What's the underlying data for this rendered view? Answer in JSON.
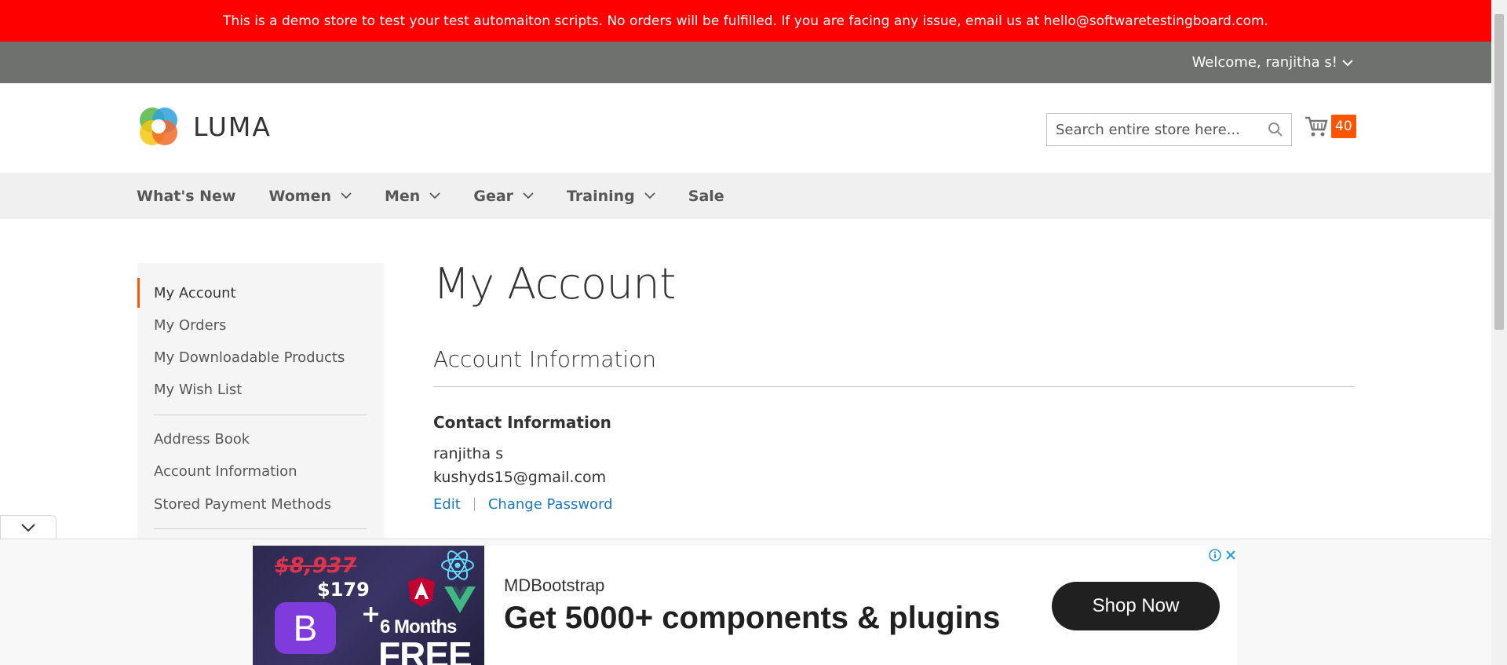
{
  "demo_notice": "This is a demo store to test your test automaiton scripts. No orders will be fulfilled. If you are facing any issue, email us at hello@softwaretestingboard.com.",
  "header": {
    "welcome": "Welcome, ranjitha s!",
    "logo_text": "LUMA",
    "search_placeholder": "Search entire store here...",
    "cart_count": "40"
  },
  "nav": {
    "items": [
      {
        "label": "What's New",
        "has_dropdown": false
      },
      {
        "label": "Women",
        "has_dropdown": true
      },
      {
        "label": "Men",
        "has_dropdown": true
      },
      {
        "label": "Gear",
        "has_dropdown": true
      },
      {
        "label": "Training",
        "has_dropdown": true
      },
      {
        "label": "Sale",
        "has_dropdown": false
      }
    ]
  },
  "sidebar": {
    "items": [
      {
        "label": "My Account",
        "active": true
      },
      {
        "label": "My Orders"
      },
      {
        "label": "My Downloadable Products"
      },
      {
        "label": "My Wish List"
      },
      {
        "label": "Address Book"
      },
      {
        "label": "Account Information"
      },
      {
        "label": "Stored Payment Methods"
      }
    ]
  },
  "main": {
    "title": "My Account",
    "section_title": "Account Information",
    "contact": {
      "title": "Contact Information",
      "name": "ranjitha s",
      "email": "kushyds15@gmail.com",
      "edit_label": "Edit",
      "change_password_label": "Change Password"
    }
  },
  "ad": {
    "old_price": "$8,937",
    "new_price": "$179",
    "b_logo": "B",
    "plus": "+",
    "months": "6 Months",
    "free": "FREE",
    "brand": "MDBootstrap",
    "headline": "Get 5000+ components & plugins",
    "cta": "Shop Now"
  },
  "colors": {
    "demo_bar": "#ff0000",
    "welcome_bar": "#6e716e",
    "accent": "#ff5501",
    "link": "#1979c3"
  }
}
